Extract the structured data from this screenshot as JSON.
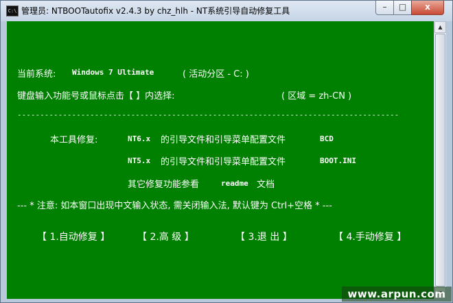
{
  "window": {
    "icon_text": "C:\\",
    "title": "管理员:  NTBOOTautofix v2.4.3 by chz_hlh - NT系统引导自动修复工具",
    "controls": {
      "minimize": "–",
      "maximize": "□",
      "close": "x"
    }
  },
  "console": {
    "system_label": "当前系统:",
    "system_value": "Windows 7 Ultimate",
    "active_partition": "( 活动分区 - C: )",
    "prompt": "键盘输入功能号或鼠标点击【 】内选择:",
    "locale": "( 区域 = zh-CN )",
    "divider": "------------------------------------------------------------------------------------",
    "fix_label": "本工具修复:",
    "fix_line1_code": "NT6.x",
    "fix_line1_text": "的引导文件和引导菜单配置文件",
    "fix_line1_file": "BCD",
    "fix_line2_code": "NT5.x",
    "fix_line2_text": "的引导文件和引导菜单配置文件",
    "fix_line2_file": "BOOT.INI",
    "fix_line3_text": "其它修复功能参看",
    "fix_line3_file": "readme",
    "fix_line3_suffix": "文档",
    "notice": "--- * 注意: 如本窗口出现中文输入状态, 需关闭输入法, 默认键为 Ctrl+空格 * ---"
  },
  "menu": [
    {
      "label": "【 1.自动修复 】"
    },
    {
      "label": "【 2.高  级 】"
    },
    {
      "label": "【 3.退  出 】"
    },
    {
      "label": "【 4.手动修复 】"
    }
  ],
  "watermark": "www.arpun.com",
  "colors": {
    "console_bg": "#008000",
    "console_text": "#ffffff"
  }
}
